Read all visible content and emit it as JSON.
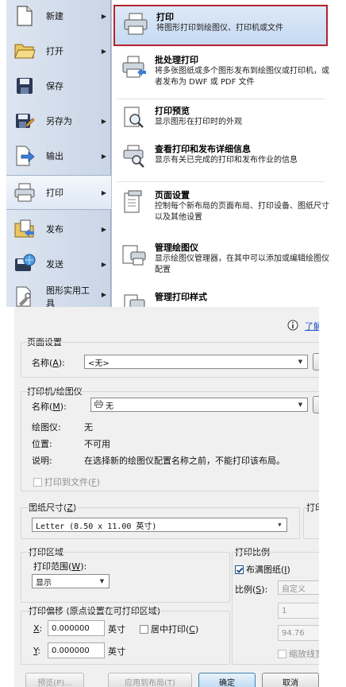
{
  "menu": {
    "left_items": [
      {
        "label": "新建",
        "icon": "new-doc-icon",
        "arrow": "▶"
      },
      {
        "label": "打开",
        "icon": "folder-icon",
        "arrow": "▶"
      },
      {
        "label": "保存",
        "icon": "save-icon",
        "arrow": ""
      },
      {
        "label": "另存为",
        "icon": "save-as-icon",
        "arrow": "▶"
      },
      {
        "label": "输出",
        "icon": "export-icon",
        "arrow": "▶"
      },
      {
        "label": "打印",
        "icon": "printer-icon",
        "arrow": "▶"
      },
      {
        "label": "发布",
        "icon": "publish-icon",
        "arrow": "▶"
      },
      {
        "label": "发送",
        "icon": "send-icon",
        "arrow": "▶"
      },
      {
        "label": "图形实用工具",
        "icon": "drawing-utilities-icon",
        "arrow": "▶"
      }
    ],
    "right_items": [
      {
        "title": "打印",
        "desc": "将图形打印到绘图仪、打印机或文件",
        "icon": "printer-icon"
      },
      {
        "title": "批处理打印",
        "desc": "将多张图纸或多个图形发布到绘图仪或打印机，或者发布为 DWF 或 PDF 文件",
        "icon": "batch-plot-icon"
      },
      {
        "title": "打印预览",
        "desc": "显示图形在打印时的外观",
        "icon": "plot-preview-icon"
      },
      {
        "title": "查看打印和发布详细信息",
        "desc": "显示有关已完成的打印和发布作业的信息",
        "icon": "plot-details-icon"
      },
      {
        "title": "页面设置",
        "desc": "控制每个新布局的页面布局、打印设备、图纸尺寸以及其他设置",
        "icon": "page-setup-icon"
      },
      {
        "title": "管理绘图仪",
        "desc": "显示绘图仪管理器，在其中可以添加或编辑绘图仪配置",
        "icon": "plotter-manager-icon"
      },
      {
        "title": "管理打印样式",
        "desc": "",
        "icon": "plot-style-icon"
      }
    ]
  },
  "dialog": {
    "help_link": "了解",
    "page_setup": {
      "title": "页面设置",
      "name_label": "名称",
      "name_key": "A",
      "name_value": "<无>"
    },
    "printer": {
      "title": "打印机/绘图仪",
      "name_label": "名称",
      "name_key": "M",
      "name_value": "无",
      "plotter_label": "绘图仪:",
      "plotter_value": "无",
      "location_label": "位置:",
      "location_value": "不可用",
      "desc_label": "说明:",
      "desc_value": "在选择新的绘图仪配置名称之前，不能打印该布局。",
      "plot_to_file": "打印到文件",
      "plot_to_file_key": "F"
    },
    "paper_size": {
      "title": "图纸尺寸",
      "key": "Z",
      "value": "Letter (8.50 x 11.00 英寸)",
      "copies_title": "打印"
    },
    "plot_area": {
      "title": "打印区域",
      "range_label": "打印范围",
      "range_key": "W",
      "range_value": "显示"
    },
    "plot_scale": {
      "title": "打印比例",
      "fit_label": "布满图纸",
      "fit_key": "I",
      "scale_label": "比例",
      "scale_key": "S",
      "scale_value": "自定义",
      "value1": "1",
      "value2": "94.76",
      "lineweights": "缩放线宽"
    },
    "offset": {
      "title": "打印偏移 (原点设置在可打印区域)",
      "x_label": "X",
      "x_value": "0.000000",
      "x_unit": "英寸",
      "center_label": "居中打印",
      "center_key": "C",
      "y_label": "Y",
      "y_value": "0.000000",
      "y_unit": "英寸"
    },
    "buttons": {
      "preview": "预览(P)...",
      "apply": "应用到布局(T)",
      "ok": "确定",
      "cancel": "取消"
    }
  },
  "colors": {
    "highlight_border": "#b2232c",
    "menu_sidebar": "#c9d5e6",
    "dialog_bg": "#f0f0f0"
  }
}
